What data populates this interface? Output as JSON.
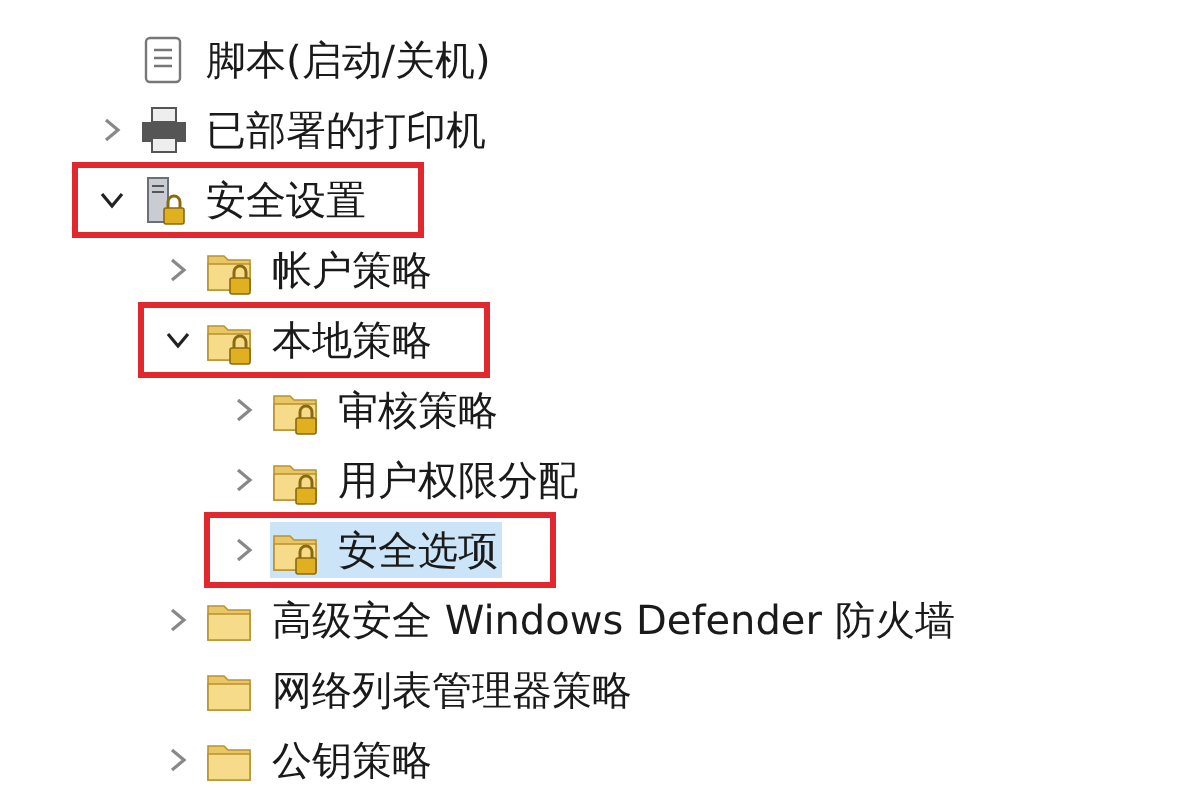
{
  "tree": [
    {
      "label": "脚本(启动/关机)",
      "kind": "script",
      "locked": false,
      "selected": false,
      "annotated": false
    },
    {
      "label": "已部署的打印机",
      "kind": "printer",
      "locked": false,
      "expanded": false,
      "selected": false,
      "annotated": false
    },
    {
      "label": "安全设置",
      "kind": "server",
      "locked": true,
      "expanded": true,
      "selected": false,
      "annotated": true,
      "children": [
        {
          "label": "帐户策略",
          "kind": "folder",
          "locked": true,
          "expanded": false,
          "selected": false,
          "annotated": false
        },
        {
          "label": "本地策略",
          "kind": "folder",
          "locked": true,
          "expanded": true,
          "selected": false,
          "annotated": true,
          "children": [
            {
              "label": "审核策略",
              "kind": "folder",
              "locked": true,
              "expanded": false,
              "selected": false,
              "annotated": false
            },
            {
              "label": "用户权限分配",
              "kind": "folder",
              "locked": true,
              "expanded": false,
              "selected": false,
              "annotated": false
            },
            {
              "label": "安全选项",
              "kind": "folder",
              "locked": true,
              "expanded": false,
              "selected": true,
              "annotated": true
            }
          ]
        },
        {
          "label": "高级安全 Windows Defender 防火墙",
          "kind": "folder",
          "locked": false,
          "expanded": false,
          "selected": false,
          "annotated": false
        },
        {
          "label": "网络列表管理器策略",
          "kind": "folder",
          "locked": false,
          "selected": false,
          "annotated": false
        },
        {
          "label": "公钥策略",
          "kind": "folder",
          "locked": false,
          "expanded": false,
          "selected": false,
          "annotated": false
        }
      ]
    }
  ]
}
